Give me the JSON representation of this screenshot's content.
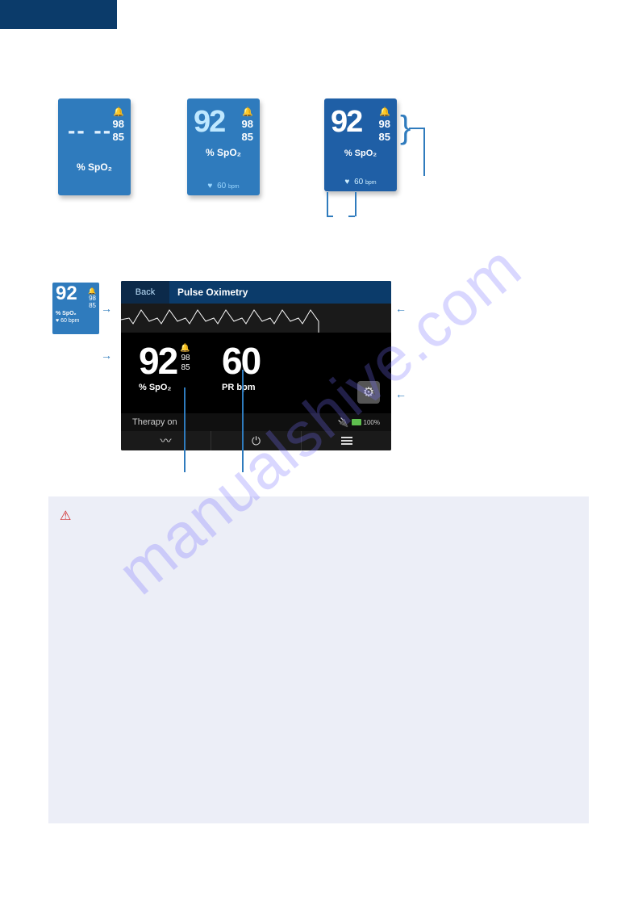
{
  "watermark": "manualshive.com",
  "tiles": {
    "t1": {
      "dash": "-- --",
      "hi": "98",
      "lo": "85",
      "label": "% SpO₂"
    },
    "t2": {
      "value": "92",
      "hi": "98",
      "lo": "85",
      "label": "% SpO₂",
      "bpm_value": "60",
      "bpm_unit": "bpm"
    },
    "t3": {
      "value": "92",
      "hi": "98",
      "lo": "85",
      "label": "% SpO₂",
      "bpm_value": "60",
      "bpm_unit": "bpm"
    }
  },
  "mini": {
    "value": "92",
    "hi": "98",
    "lo": "85",
    "label": "% SpO₂",
    "bpm": "♥ 60 bpm"
  },
  "panel": {
    "back": "Back",
    "title": "Pulse Oximetry",
    "spo2": {
      "value": "92",
      "hi": "98",
      "lo": "85",
      "label": "% SpO₂"
    },
    "pr": {
      "value": "60",
      "label": "PR bpm"
    },
    "status": "Therapy on",
    "battery_pct": "100%"
  }
}
